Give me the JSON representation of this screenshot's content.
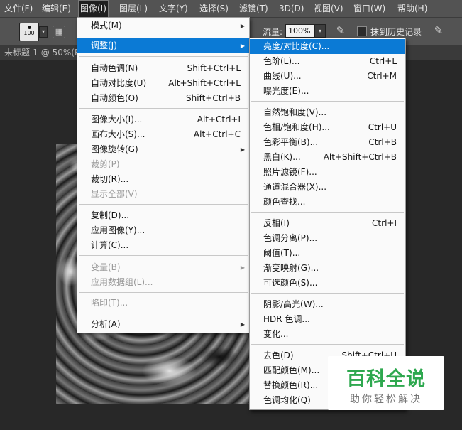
{
  "menubar": {
    "items": [
      "文件(F)",
      "编辑(E)",
      "图像(I)",
      "图层(L)",
      "文字(Y)",
      "选择(S)",
      "滤镜(T)",
      "3D(D)",
      "视图(V)",
      "窗口(W)",
      "帮助(H)"
    ],
    "active_index": 2
  },
  "options": {
    "brush_size": "100",
    "flow_label": "流量:",
    "flow_value": "100%",
    "history_label": "抹到历史记录"
  },
  "document": {
    "tab_label": "未标题-1 @ 50%(R"
  },
  "image_menu": {
    "items": [
      {
        "label": "模式(M)",
        "shortcut": "",
        "submenu": true
      },
      {
        "label": "调整(J)",
        "shortcut": "",
        "submenu": true,
        "highlighted": true
      },
      {
        "label": "自动色调(N)",
        "shortcut": "Shift+Ctrl+L"
      },
      {
        "label": "自动对比度(U)",
        "shortcut": "Alt+Shift+Ctrl+L"
      },
      {
        "label": "自动颜色(O)",
        "shortcut": "Shift+Ctrl+B"
      },
      {
        "label": "图像大小(I)...",
        "shortcut": "Alt+Ctrl+I"
      },
      {
        "label": "画布大小(S)...",
        "shortcut": "Alt+Ctrl+C"
      },
      {
        "label": "图像旋转(G)",
        "shortcut": "",
        "submenu": true
      },
      {
        "label": "裁剪(P)",
        "shortcut": "",
        "disabled": true
      },
      {
        "label": "裁切(R)...",
        "shortcut": ""
      },
      {
        "label": "显示全部(V)",
        "shortcut": "",
        "disabled": true
      },
      {
        "label": "复制(D)...",
        "shortcut": ""
      },
      {
        "label": "应用图像(Y)...",
        "shortcut": ""
      },
      {
        "label": "计算(C)...",
        "shortcut": ""
      },
      {
        "label": "变量(B)",
        "shortcut": "",
        "submenu": true,
        "disabled": true
      },
      {
        "label": "应用数据组(L)...",
        "shortcut": "",
        "disabled": true
      },
      {
        "label": "陷印(T)...",
        "shortcut": "",
        "disabled": true
      },
      {
        "label": "分析(A)",
        "shortcut": "",
        "submenu": true
      }
    ]
  },
  "adjust_menu": {
    "items": [
      {
        "label": "亮度/对比度(C)...",
        "shortcut": "",
        "highlighted": true
      },
      {
        "label": "色阶(L)...",
        "shortcut": "Ctrl+L"
      },
      {
        "label": "曲线(U)...",
        "shortcut": "Ctrl+M"
      },
      {
        "label": "曝光度(E)...",
        "shortcut": ""
      },
      {
        "label": "自然饱和度(V)...",
        "shortcut": ""
      },
      {
        "label": "色相/饱和度(H)...",
        "shortcut": "Ctrl+U"
      },
      {
        "label": "色彩平衡(B)...",
        "shortcut": "Ctrl+B"
      },
      {
        "label": "黑白(K)...",
        "shortcut": "Alt+Shift+Ctrl+B"
      },
      {
        "label": "照片滤镜(F)...",
        "shortcut": ""
      },
      {
        "label": "通道混合器(X)...",
        "shortcut": ""
      },
      {
        "label": "颜色查找...",
        "shortcut": ""
      },
      {
        "label": "反相(I)",
        "shortcut": "Ctrl+I"
      },
      {
        "label": "色调分离(P)...",
        "shortcut": ""
      },
      {
        "label": "阈值(T)...",
        "shortcut": ""
      },
      {
        "label": "渐变映射(G)...",
        "shortcut": ""
      },
      {
        "label": "可选颜色(S)...",
        "shortcut": ""
      },
      {
        "label": "阴影/高光(W)...",
        "shortcut": ""
      },
      {
        "label": "HDR 色调...",
        "shortcut": ""
      },
      {
        "label": "变化...",
        "shortcut": ""
      },
      {
        "label": "去色(D)",
        "shortcut": "Shift+Ctrl+U"
      },
      {
        "label": "匹配颜色(M)...",
        "shortcut": ""
      },
      {
        "label": "替换颜色(R)...",
        "shortcut": ""
      },
      {
        "label": "色调均化(Q)",
        "shortcut": ""
      }
    ]
  },
  "watermark": {
    "title": "百科全说",
    "subtitle": "助你轻松解决"
  },
  "colors": {
    "highlight": "#0b7ad5",
    "menu_bg": "#fafafa",
    "toolbar_bg": "#535353",
    "watermark_green": "#2ea84f"
  }
}
